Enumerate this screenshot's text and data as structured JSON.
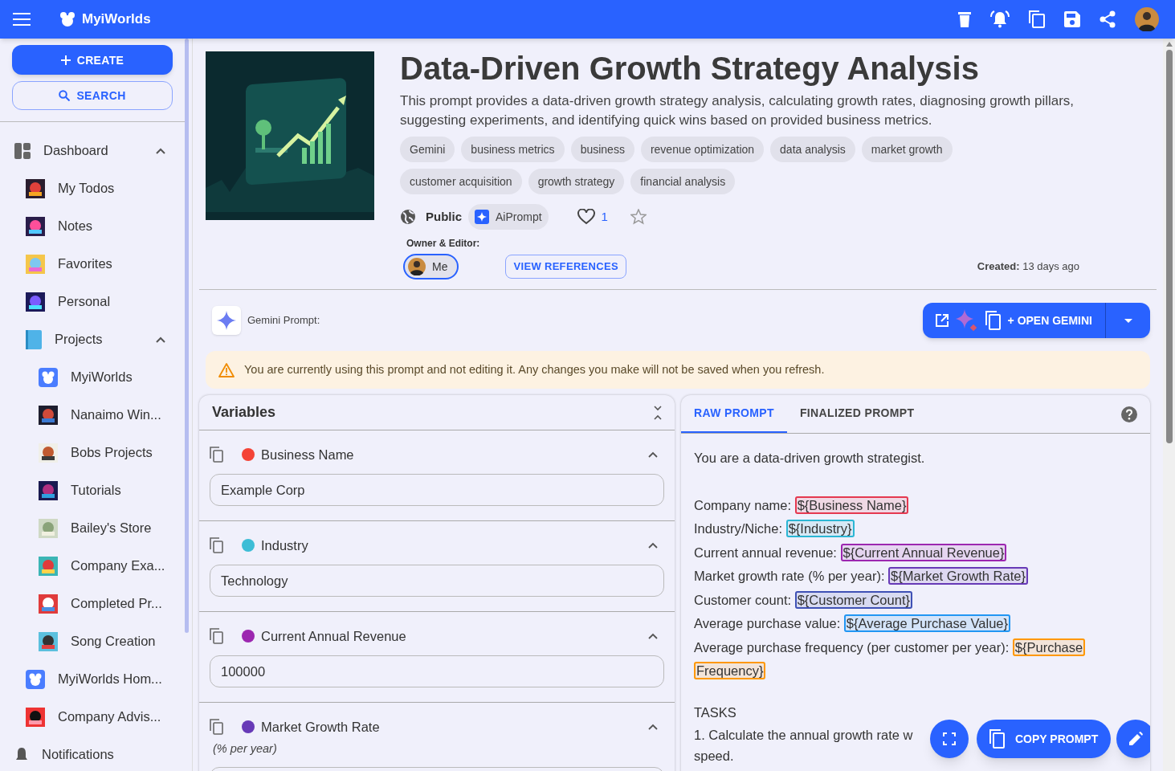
{
  "app_bar": {
    "brand": "MyiWorlds"
  },
  "sidebar": {
    "create_button": "CREATE",
    "search_button": "SEARCH",
    "items": [
      {
        "label": "Dashboard",
        "kind": "section",
        "expanded": true,
        "children": [
          {
            "label": "My Todos"
          },
          {
            "label": "Notes"
          },
          {
            "label": "Favorites"
          },
          {
            "label": "Personal"
          },
          {
            "label": "Projects",
            "expanded": true,
            "children": [
              {
                "label": "MyiWorlds",
                "kind": "logo"
              },
              {
                "label": "Nanaimo Win..."
              },
              {
                "label": "Bobs Projects"
              },
              {
                "label": "Tutorials"
              },
              {
                "label": "Bailey's Store"
              },
              {
                "label": "Company Exa..."
              },
              {
                "label": "Completed Pr..."
              },
              {
                "label": "Song Creation"
              }
            ]
          },
          {
            "label": "MyiWorlds Hom...",
            "kind": "logo"
          },
          {
            "label": "Company Advis..."
          }
        ]
      },
      {
        "label": "Notifications",
        "kind": "bell"
      }
    ]
  },
  "header": {
    "title": "Data-Driven Growth Strategy Analysis",
    "description": "This prompt provides a data-driven growth strategy analysis, calculating growth rates, diagnosing growth pillars, suggesting experiments, and identifying quick wins based on provided business metrics.",
    "tags": [
      "Gemini",
      "business metrics",
      "business",
      "revenue optimization",
      "data analysis",
      "market growth",
      "customer acquisition",
      "growth strategy",
      "financial analysis"
    ],
    "visibility": "Public",
    "type_chip": "AiPrompt",
    "likes": "1",
    "liked": false,
    "starred": false,
    "owner_label": "Owner & Editor:",
    "owner_chip": "Me",
    "references_button": "VIEW REFERENCES",
    "created_label": "Created:",
    "created_value": "13 days ago"
  },
  "gemini_bar": {
    "label": "Gemini Prompt:",
    "open_button": "+ OPEN GEMINI"
  },
  "warning": "You are currently using this prompt and not editing it. Any changes you make will not be saved when you refresh.",
  "variables": {
    "title": "Variables",
    "items": [
      {
        "name": "Business Name",
        "color": "#f44336",
        "value": "Example Corp",
        "expanded": true
      },
      {
        "name": "Industry",
        "color": "#3dbdd6",
        "value": "Technology",
        "expanded": true
      },
      {
        "name": "Current Annual Revenue",
        "color": "#9c27b0",
        "value": "100000",
        "expanded": true
      },
      {
        "name": "Market Growth Rate",
        "color": "#673ab7",
        "note": "(% per year)",
        "expanded": true
      }
    ]
  },
  "prompt": {
    "tabs": [
      {
        "label": "RAW PROMPT",
        "selected": true
      },
      {
        "label": "FINALIZED PROMPT",
        "selected": false
      }
    ],
    "intro": "You are a data-driven growth strategist.",
    "fields": [
      {
        "label": "Company name:",
        "variable": "${Business Name}",
        "color": "#e53950"
      },
      {
        "label": "Industry/Niche:",
        "variable": "${Industry}",
        "color": "#2bb6d4"
      },
      {
        "label": "Current annual revenue:",
        "variable": "${Current Annual Revenue}",
        "color": "#9c27b0"
      },
      {
        "label": "Market growth rate (% per year):",
        "variable": "${Market Growth Rate}",
        "color": "#673ab7"
      },
      {
        "label": "Customer count:",
        "variable": "${Customer Count}",
        "color": "#3f51b5"
      },
      {
        "label": "Average purchase value:",
        "variable": "${Average Purchase Value}",
        "color": "#2196f3"
      },
      {
        "label": "Average purchase frequency (per customer per year):",
        "variable": "${Purchase Frequency}",
        "color": "#ff9800"
      }
    ],
    "tasks_heading": "TASKS",
    "task_lines": [
      "1. Calculate the annual growth rate w",
      "speed."
    ],
    "copy_button": "COPY PROMPT"
  }
}
